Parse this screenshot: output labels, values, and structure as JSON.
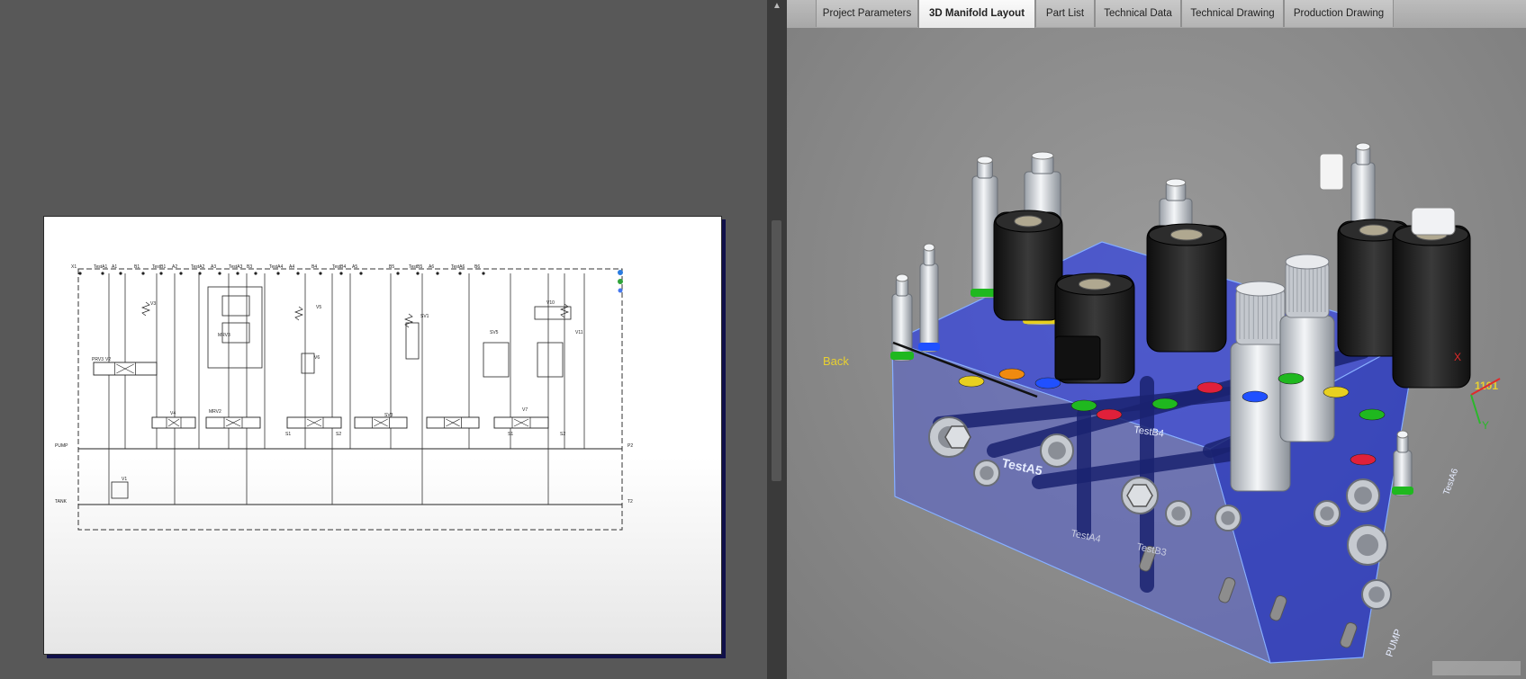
{
  "tabs": [
    {
      "label": "Project Parameters",
      "active": false
    },
    {
      "label": "3D Manifold Layout",
      "active": true
    },
    {
      "label": "Part List",
      "active": false
    },
    {
      "label": "Technical Data",
      "active": false
    },
    {
      "label": "Technical Drawing",
      "active": false
    },
    {
      "label": "Production Drawing",
      "active": false
    }
  ],
  "schematic": {
    "port_labels": [
      "X1",
      "TestA1",
      "A1",
      "B1",
      "TestB1",
      "A2",
      "TestA2",
      "A3",
      "TestA3",
      "B3",
      "TestA4",
      "A4",
      "B4",
      "TestB4",
      "A5",
      "B5",
      "TestB5",
      "A6",
      "TestA6",
      "B6"
    ],
    "component_labels": [
      "PRV3",
      "V3",
      "MRV2",
      "MRV3",
      "V5",
      "V6",
      "SV1",
      "V10",
      "V2",
      "V4",
      "SV3",
      "SV5",
      "V7",
      "V11",
      "V1",
      "S1",
      "S2",
      "S1",
      "S2"
    ],
    "rail_labels": {
      "pump": "PUMP",
      "tank": "TANK",
      "p2": "P2",
      "t2": "T2"
    }
  },
  "model": {
    "face_labels": {
      "back": "Back",
      "test_a5": "TestA5",
      "test_b4": "TestB4",
      "test_a4": "TestA4",
      "test_b3": "TestB3",
      "pump": "PUMP",
      "test_a6": "TestA6",
      "label_1101": "1101"
    },
    "axis_labels": {
      "x": "X",
      "y": "Y"
    },
    "colors": {
      "manifold": "#2b3bd6",
      "channel": "#1a2270",
      "valve_body": "#d8dde4",
      "coil": "#1c1c1c",
      "ring_green": "#1fb81f",
      "ring_red": "#e0203a",
      "ring_yellow": "#e8d020",
      "ring_blue": "#2050ff",
      "ring_orange": "#f08a10",
      "label": "#e8d030"
    }
  },
  "colors": {
    "left_background": "#585858",
    "viewport_background": "#8a8a8a",
    "sheet_border": "#10104a"
  }
}
